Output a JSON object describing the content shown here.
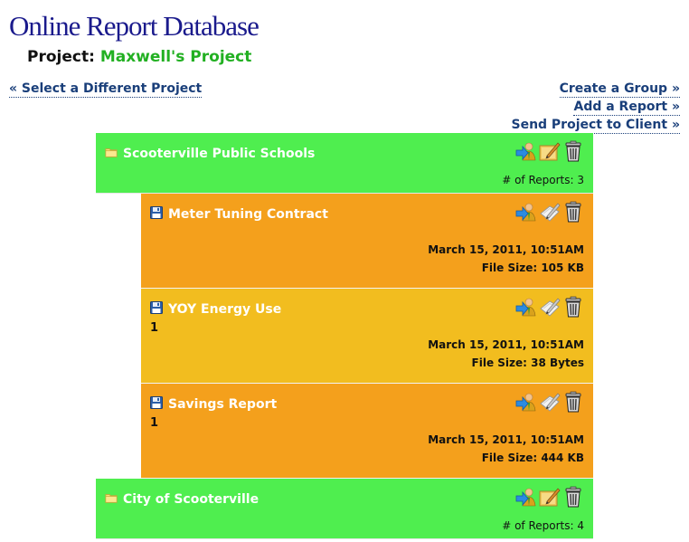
{
  "app": {
    "title": "Online Report Database"
  },
  "project": {
    "label": "Project:",
    "name": "Maxwell's Project"
  },
  "nav": {
    "select_project": "« Select a Different Project",
    "create_group": "Create a Group »",
    "add_report": "Add a Report »",
    "send_project": "Send Project to Client »"
  },
  "groups": [
    {
      "name": "Scooterville Public Schools",
      "reports_count": "# of Reports: 3",
      "reports": [
        {
          "name": "Meter Tuning Contract",
          "desc": "",
          "date": "March 15, 2011, 10:51AM",
          "size_label": "File Size:",
          "size": "105 KB"
        },
        {
          "name": "YOY Energy Use",
          "desc": "1",
          "date": "March 15, 2011, 10:51AM",
          "size_label": "File Size:",
          "size": "38 Bytes"
        },
        {
          "name": "Savings Report",
          "desc": "1",
          "date": "March 15, 2011, 10:51AM",
          "size_label": "File Size:",
          "size": "444 KB"
        }
      ]
    },
    {
      "name": "City of Scooterville",
      "reports_count": "# of Reports: 4"
    }
  ],
  "colors": {
    "title": "#1a1a8c",
    "project_name": "#22b022",
    "link": "#1a3f7a",
    "group_bg": "#4fee4f",
    "report_orange": "#f4a01c",
    "report_yellow": "#f2bd1f"
  },
  "icons": {
    "group": "folder-icon",
    "report": "floppy-disk-icon",
    "move": "move-person-arrow-icon",
    "edit_group": "edit-pencil-pad-icon",
    "edit_report": "edit-pencil-paper-icon",
    "delete": "trash-can-icon"
  }
}
